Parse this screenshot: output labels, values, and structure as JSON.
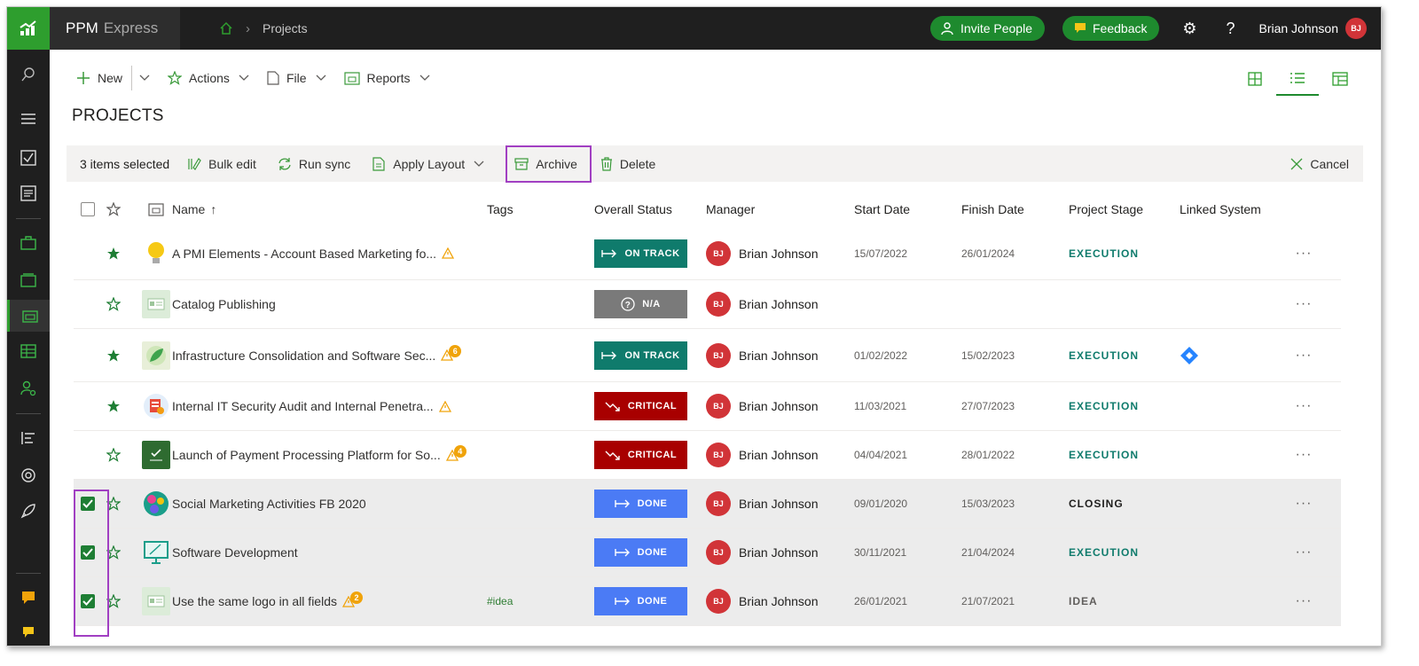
{
  "app": {
    "name": "PPM",
    "name_sub": "Express"
  },
  "breadcrumb": {
    "current": "Projects"
  },
  "top_actions": {
    "invite_label": "Invite People",
    "feedback_label": "Feedback",
    "user_name": "Brian Johnson",
    "user_initials": "BJ"
  },
  "toolbar": {
    "new_label": "New",
    "actions_label": "Actions",
    "file_label": "File",
    "reports_label": "Reports"
  },
  "page": {
    "title": "PROJECTS"
  },
  "selection_bar": {
    "count_label": "3 items selected",
    "bulk_edit_label": "Bulk edit",
    "run_sync_label": "Run sync",
    "apply_layout_label": "Apply Layout",
    "archive_label": "Archive",
    "delete_label": "Delete",
    "cancel_label": "Cancel"
  },
  "table": {
    "headers": {
      "name": "Name",
      "tags": "Tags",
      "status": "Overall Status",
      "manager": "Manager",
      "start": "Start Date",
      "finish": "Finish Date",
      "stage": "Project Stage",
      "linked": "Linked System"
    },
    "rows": [
      {
        "name": "A PMI Elements - Account Based Marketing fo...",
        "tags": "",
        "status": "ON TRACK",
        "manager": "Brian Johnson",
        "initials": "BJ",
        "start": "15/07/2022",
        "finish": "26/01/2024",
        "stage": "EXECUTION",
        "warn_count": ""
      },
      {
        "name": "Catalog Publishing",
        "tags": "",
        "status": "N/A",
        "manager": "Brian Johnson",
        "initials": "BJ",
        "start": "",
        "finish": "",
        "stage": "",
        "warn_count": ""
      },
      {
        "name": "Infrastructure Consolidation and Software Sec...",
        "tags": "",
        "status": "ON TRACK",
        "manager": "Brian Johnson",
        "initials": "BJ",
        "start": "01/02/2022",
        "finish": "15/02/2023",
        "stage": "EXECUTION",
        "warn_count": "6"
      },
      {
        "name": "Internal IT Security Audit and Internal Penetra...",
        "tags": "",
        "status": "CRITICAL",
        "manager": "Brian Johnson",
        "initials": "BJ",
        "start": "11/03/2021",
        "finish": "27/07/2023",
        "stage": "EXECUTION",
        "warn_count": ""
      },
      {
        "name": "Launch of Payment Processing Platform for So...",
        "tags": "",
        "status": "CRITICAL",
        "manager": "Brian Johnson",
        "initials": "BJ",
        "start": "04/04/2021",
        "finish": "28/01/2022",
        "stage": "EXECUTION",
        "warn_count": "4"
      },
      {
        "name": "Social Marketing Activities FB 2020",
        "tags": "",
        "status": "DONE",
        "manager": "Brian Johnson",
        "initials": "BJ",
        "start": "09/01/2020",
        "finish": "15/03/2023",
        "stage": "CLOSING",
        "warn_count": ""
      },
      {
        "name": "Software Development",
        "tags": "",
        "status": "DONE",
        "manager": "Brian Johnson",
        "initials": "BJ",
        "start": "30/11/2021",
        "finish": "21/04/2024",
        "stage": "EXECUTION",
        "warn_count": ""
      },
      {
        "name": "Use the same logo in all fields",
        "tags": "#idea",
        "status": "DONE",
        "manager": "Brian Johnson",
        "initials": "BJ",
        "start": "26/01/2021",
        "finish": "21/07/2021",
        "stage": "IDEA",
        "warn_count": "2"
      }
    ]
  },
  "colors": {
    "accent": "#1e8a2e",
    "on_track": "#0f7b6c",
    "na": "#7a7a7a",
    "critical": "#a80000",
    "done": "#4b7bf5",
    "highlight": "#a13fc2",
    "execution_text": "#0f7b6c",
    "closing_text": "#201f1e",
    "idea_text": "#605e5c"
  }
}
